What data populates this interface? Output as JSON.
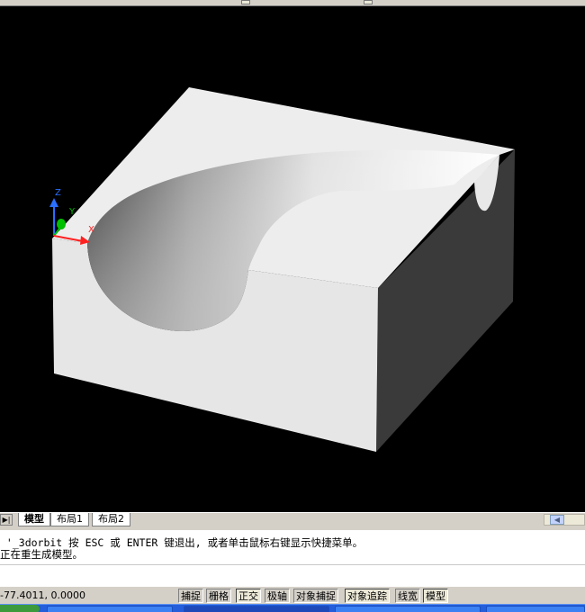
{
  "viewport": {
    "background": "#000000",
    "ucs": {
      "z_label": "Z",
      "y_label": "Y",
      "x_label": "X"
    },
    "model_colors": {
      "top_face": "#ececec",
      "front_face": "#e6e6e6",
      "right_face": "#3a3a3a"
    }
  },
  "layout_tabs": {
    "nav_icon": "play-end-icon",
    "tabs": [
      {
        "label": "模型",
        "active": true
      },
      {
        "label": "布局1",
        "active": false
      },
      {
        "label": "布局2",
        "active": false
      }
    ],
    "scroll_icon": "scroll-left-icon"
  },
  "command_window": {
    "line1": " '_3dorbit 按 ESC 或 ENTER 键退出, 或者单击鼠标右键显示快捷菜单。",
    "line2": "正在重生成模型。"
  },
  "status_bar": {
    "coordinates": "-77.4011, 0.0000",
    "buttons": [
      {
        "label": "捕捉",
        "on": false
      },
      {
        "label": "栅格",
        "on": false
      },
      {
        "label": "正交",
        "on": true
      },
      {
        "label": "极轴",
        "on": false
      },
      {
        "label": "对象捕捉",
        "on": false
      },
      {
        "label": "对象追踪",
        "on": true
      },
      {
        "label": "线宽",
        "on": false
      },
      {
        "label": "模型",
        "on": true
      }
    ]
  },
  "taskbar": {
    "color": "#245edb"
  }
}
